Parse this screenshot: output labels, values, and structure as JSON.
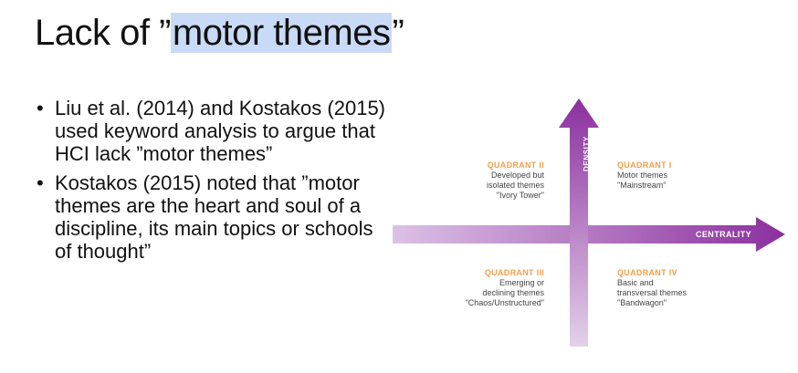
{
  "title": {
    "prefix": "Lack of ”",
    "highlight": "motor themes",
    "suffix": "”"
  },
  "bullets": [
    "Liu et al. (2014) and Kostakos (2015) used keyword analysis to argue that HCI lack ”motor themes”",
    "Kostakos (2015) noted that ”motor themes are the heart and soul of a discipline, its main topics or schools of thought”"
  ],
  "bullet_symbol": "•",
  "diagram": {
    "x_axis_label": "CENTRALITY",
    "y_axis_label": "DENSITY",
    "colors": {
      "arrow_dark": "#8b2f9e",
      "arrow_light": "#dcc2e6",
      "quadrant_heading": "#f0a04b"
    },
    "quadrants": {
      "q1": {
        "heading": "QUADRANT I",
        "line1": "Motor themes",
        "line2": "\"Mainstream\"",
        "line3": ""
      },
      "q2": {
        "heading": "QUADRANT II",
        "line1": "Developed but",
        "line2": "isolated themes",
        "line3": "\"Ivory Tower\""
      },
      "q3": {
        "heading": "QUADRANT III",
        "line1": "Emerging or",
        "line2": "declining themes",
        "line3": "\"Chaos/Unstructured\""
      },
      "q4": {
        "heading": "QUADRANT IV",
        "line1": "Basic and",
        "line2": "transversal themes",
        "line3": "\"Bandwagon\""
      }
    }
  }
}
